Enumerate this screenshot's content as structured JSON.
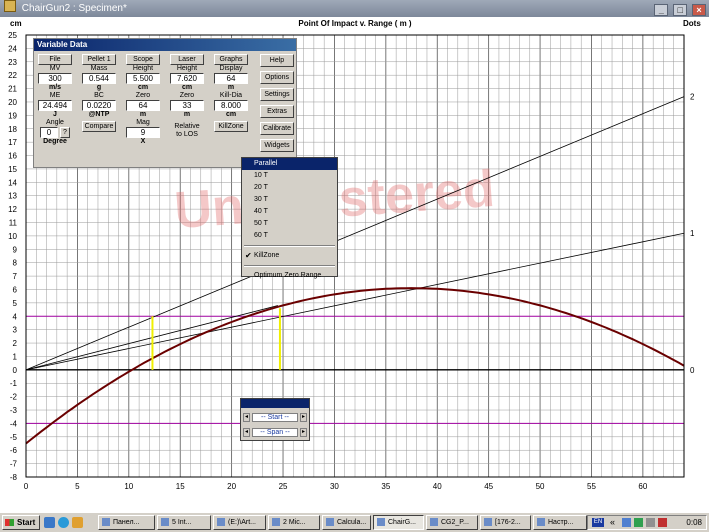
{
  "window": {
    "title": "ChairGun2 : Specimen*",
    "min": "_",
    "max": "□",
    "close": "×"
  },
  "chart": {
    "title": "Point Of Impact v. Range ( m )",
    "y_unit": "cm",
    "right_unit": "Dots",
    "watermark": "Unregistered",
    "x_ticks": [
      "0",
      "5",
      "10",
      "15",
      "20",
      "25",
      "30",
      "35",
      "40",
      "45",
      "50",
      "55",
      "60"
    ],
    "y_ticks": [
      "25",
      "24",
      "23",
      "22",
      "21",
      "20",
      "19",
      "18",
      "17",
      "16",
      "15",
      "14",
      "13",
      "12",
      "11",
      "10",
      "9",
      "8",
      "7",
      "6",
      "5",
      "4",
      "3",
      "2",
      "1",
      "0",
      "-1",
      "-2",
      "-3",
      "-4",
      "-5",
      "-6",
      "-7",
      "-8"
    ],
    "right_ticks": [
      "2",
      "1",
      "0"
    ],
    "colors": {
      "trajectory": "#6a0000",
      "killzone_band": "#a000a0",
      "marker": "#f0f000",
      "grid": "#888888"
    }
  },
  "panel": {
    "title": "Variable Data",
    "columns": [
      {
        "button": "File",
        "label1": "MV",
        "value1": "300",
        "unit1": "m/s",
        "label2": "ME",
        "value2": "24.494",
        "unit2": "J",
        "label3": "Angle"
      },
      {
        "button": "Pellet 1",
        "label1": "Mass",
        "value1": "0.544",
        "unit1": "g",
        "label2": "BC",
        "value2": "0.0220",
        "unit2": "@NTP",
        "button2": "Compare"
      },
      {
        "button": "Scope",
        "label1": "Height",
        "value1": "5.500",
        "unit1": "cm",
        "label2": "Zero",
        "value2": "64",
        "unit2": "m",
        "label3": "Mag",
        "value3": "9",
        "unit3": "X"
      },
      {
        "button": "Laser",
        "label1": "Height",
        "value1": "7.620",
        "unit1": "cm",
        "label2": "Zero",
        "value2": "33",
        "unit2": "m",
        "note1": "Relative",
        "note2": "to LOS"
      },
      {
        "button": "Graphs",
        "label1": "Display",
        "value1": "64",
        "unit1": "m",
        "label2": "Kill-Dia",
        "value2": "8.000",
        "unit2": "cm",
        "button2": "KillZone"
      }
    ],
    "angle": {
      "value": "0",
      "help": "?",
      "unit": "Degree"
    },
    "side_buttons": [
      "Help",
      "Options",
      "Settings",
      "Extras",
      "Calibrate",
      "Widgets"
    ]
  },
  "dropdown": {
    "items": [
      "Parallel",
      "10 T",
      "20 T",
      "30 T",
      "40 T",
      "50 T",
      "60 T"
    ],
    "check_mark": "✔",
    "check_item": "KillZone",
    "extra_item": "Optimum Zero Range"
  },
  "control": {
    "start": "-- Start --",
    "span": "-- Span --",
    "left": "◂",
    "right": "▸"
  },
  "taskbar": {
    "start": "Start",
    "tasks": [
      "Панел...",
      "5 Int...",
      "(E:)\\Art...",
      "2 Mic...",
      "Calcula...",
      "ChairG...",
      "CG2_P...",
      "[176-2...",
      "Настр..."
    ],
    "lang": "EN",
    "tray_chevron": "«",
    "clock": "0:08"
  }
}
